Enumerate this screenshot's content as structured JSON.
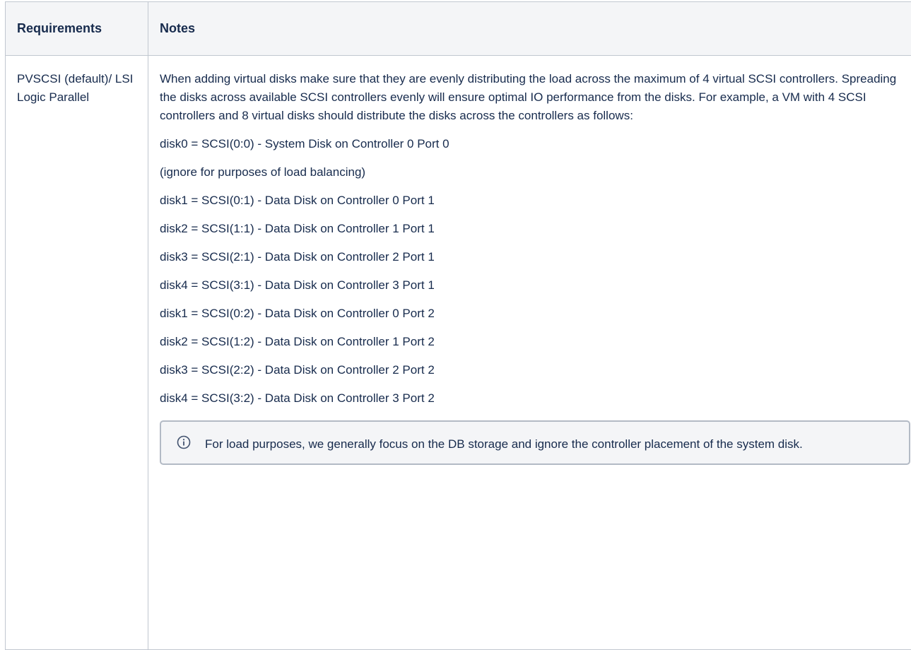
{
  "table": {
    "headers": [
      "Requirements",
      "Notes"
    ],
    "row": {
      "requirement": "PVSCSI (default)/ LSI Logic Parallel",
      "intro": "When adding virtual disks make sure that they are evenly distributing the load across the maximum of 4 virtual SCSI controllers. Spreading the disks across available SCSI controllers evenly will ensure optimal IO performance from the disks. For example, a VM with 4 SCSI controllers and 8 virtual disks should distribute the disks across the controllers as follows:",
      "lines": [
        "disk0 = SCSI(0:0) - System Disk on Controller 0 Port 0",
        "(ignore for purposes of load balancing)",
        "disk1 = SCSI(0:1) - Data Disk on Controller 0 Port 1",
        "disk2 = SCSI(1:1) - Data Disk on Controller 1 Port 1",
        "disk3 = SCSI(2:1) - Data Disk on Controller 2 Port 1",
        "disk4 = SCSI(3:1) - Data Disk on Controller 3 Port 1",
        "disk1 = SCSI(0:2) - Data Disk on Controller 0 Port 2",
        "disk2 = SCSI(1:2) - Data Disk on Controller 1 Port 2",
        "disk3 = SCSI(2:2) - Data Disk on Controller 2 Port 2",
        "disk4 = SCSI(3:2) - Data Disk on Controller 3 Port 2"
      ],
      "callout": {
        "icon": "info-icon",
        "text": "For load purposes, we generally focus on the DB storage and ignore the controller placement of the system disk."
      }
    }
  },
  "colors": {
    "border": "#c1c7d0",
    "header_bg": "#f4f5f7",
    "text": "#172b4d",
    "callout_border": "#b3bac5"
  }
}
